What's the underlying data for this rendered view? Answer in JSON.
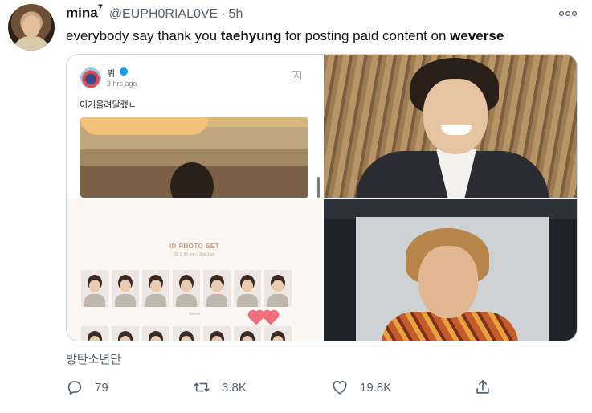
{
  "tweet": {
    "author_name": "mina",
    "author_superscript": "7",
    "handle": "@EUPH0RIAL0VE",
    "separator": "·",
    "time": "5h",
    "text_parts": [
      {
        "text": "everybody say thank you ",
        "bold": false
      },
      {
        "text": "taehyung",
        "bold": true
      },
      {
        "text": " for posting paid content on ",
        "bold": false
      },
      {
        "text": "weverse",
        "bold": true
      }
    ],
    "caption": "방탄소년단"
  },
  "media": {
    "weverse_post": {
      "name": "뷔",
      "time": "3 hrs ago",
      "text": "이거올려달랬ㄴ"
    },
    "id_photo_set": {
      "title": "ID PHOTO SET",
      "subtitle": "35 X 45 mm / 3ea 1set",
      "caption": "Sweet",
      "row1_tiles": 7,
      "row2_tiles": 7
    }
  },
  "actions": {
    "reply": {
      "icon": "reply-icon",
      "count": "79"
    },
    "retweet": {
      "icon": "retweet-icon",
      "count": "3.8K"
    },
    "like": {
      "icon": "heart-icon",
      "count": "19.8K"
    },
    "share": {
      "icon": "share-icon",
      "count": ""
    }
  },
  "colors": {
    "muted": "#536471",
    "text": "#0f1419",
    "border": "#cfd9de"
  }
}
